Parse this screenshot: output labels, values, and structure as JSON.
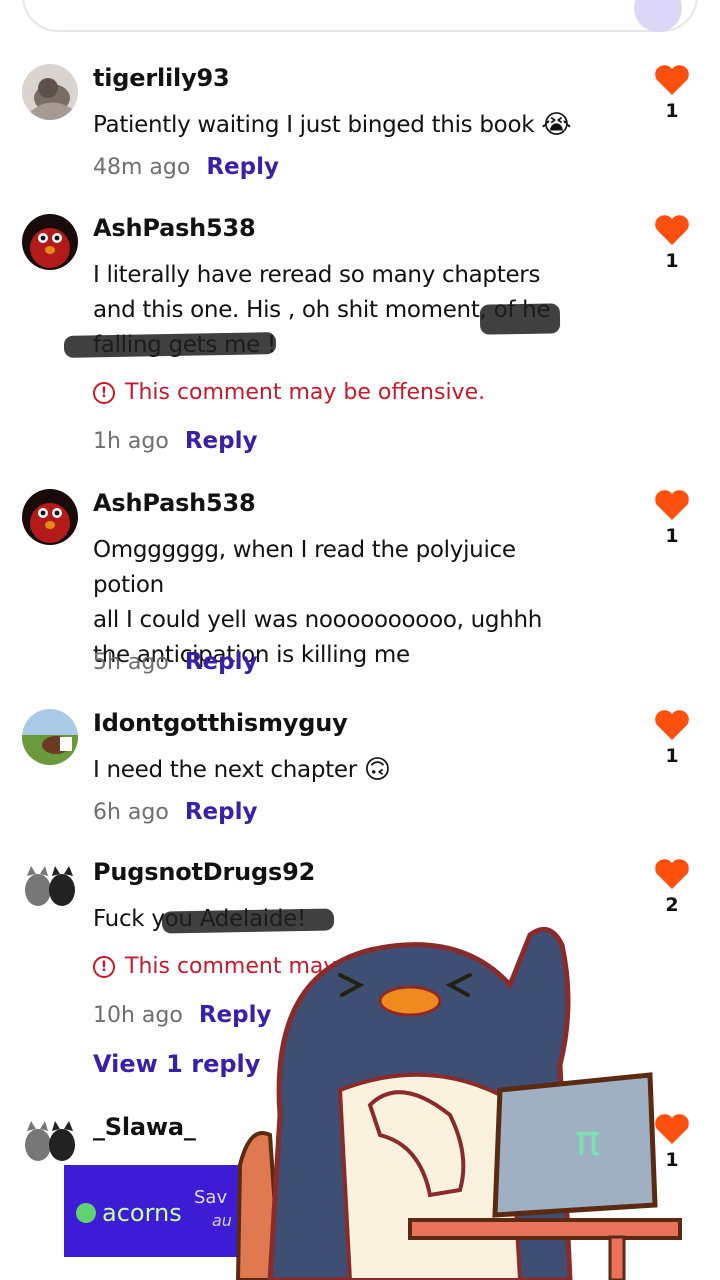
{
  "comments": [
    {
      "username": "tigerlily93",
      "text": "Patiently waiting I just binged this book",
      "emoji": "😭",
      "time": "48m ago",
      "reply_label": "Reply",
      "likes": "1"
    },
    {
      "username": "AshPash538",
      "line1": "I literally have reread so many chapters",
      "line2": "and this one. His , oh shit moment, of he",
      "line3": "falling gets me !",
      "warning": "This comment may be offensive.",
      "time": "1h ago",
      "reply_label": "Reply",
      "likes": "1"
    },
    {
      "username": "AshPash538",
      "line1": "Omgggggg, when I read the polyjuice potion",
      "line2": "all I could yell was noooooooooo, ughhh",
      "line3": "the anticipation is killing me",
      "time": "5h ago",
      "reply_label": "Reply",
      "likes": "1"
    },
    {
      "username": "Idontgotthismyguy",
      "text": "I need the next chapter",
      "emoji": "🙃",
      "time": "6h ago",
      "reply_label": "Reply",
      "likes": "1"
    },
    {
      "username": "PugsnotDrugs92",
      "text": "Fuck you Adelaide!",
      "warning": "This comment may be offensive.",
      "time": "10h ago",
      "reply_label": "Reply",
      "view_replies": "View 1 reply",
      "likes": "2"
    },
    {
      "username": "_Slawa_",
      "likes": "1"
    }
  ],
  "ad": {
    "brand": "acorns",
    "tagline": "Sav",
    "tagline2": "au"
  },
  "sticker_laptop_text": "π",
  "colors": {
    "accent": "#3a1fa8",
    "heart": "#ff4f0f",
    "warning": "#c6192b",
    "ad_bg": "#3d1cd6"
  }
}
